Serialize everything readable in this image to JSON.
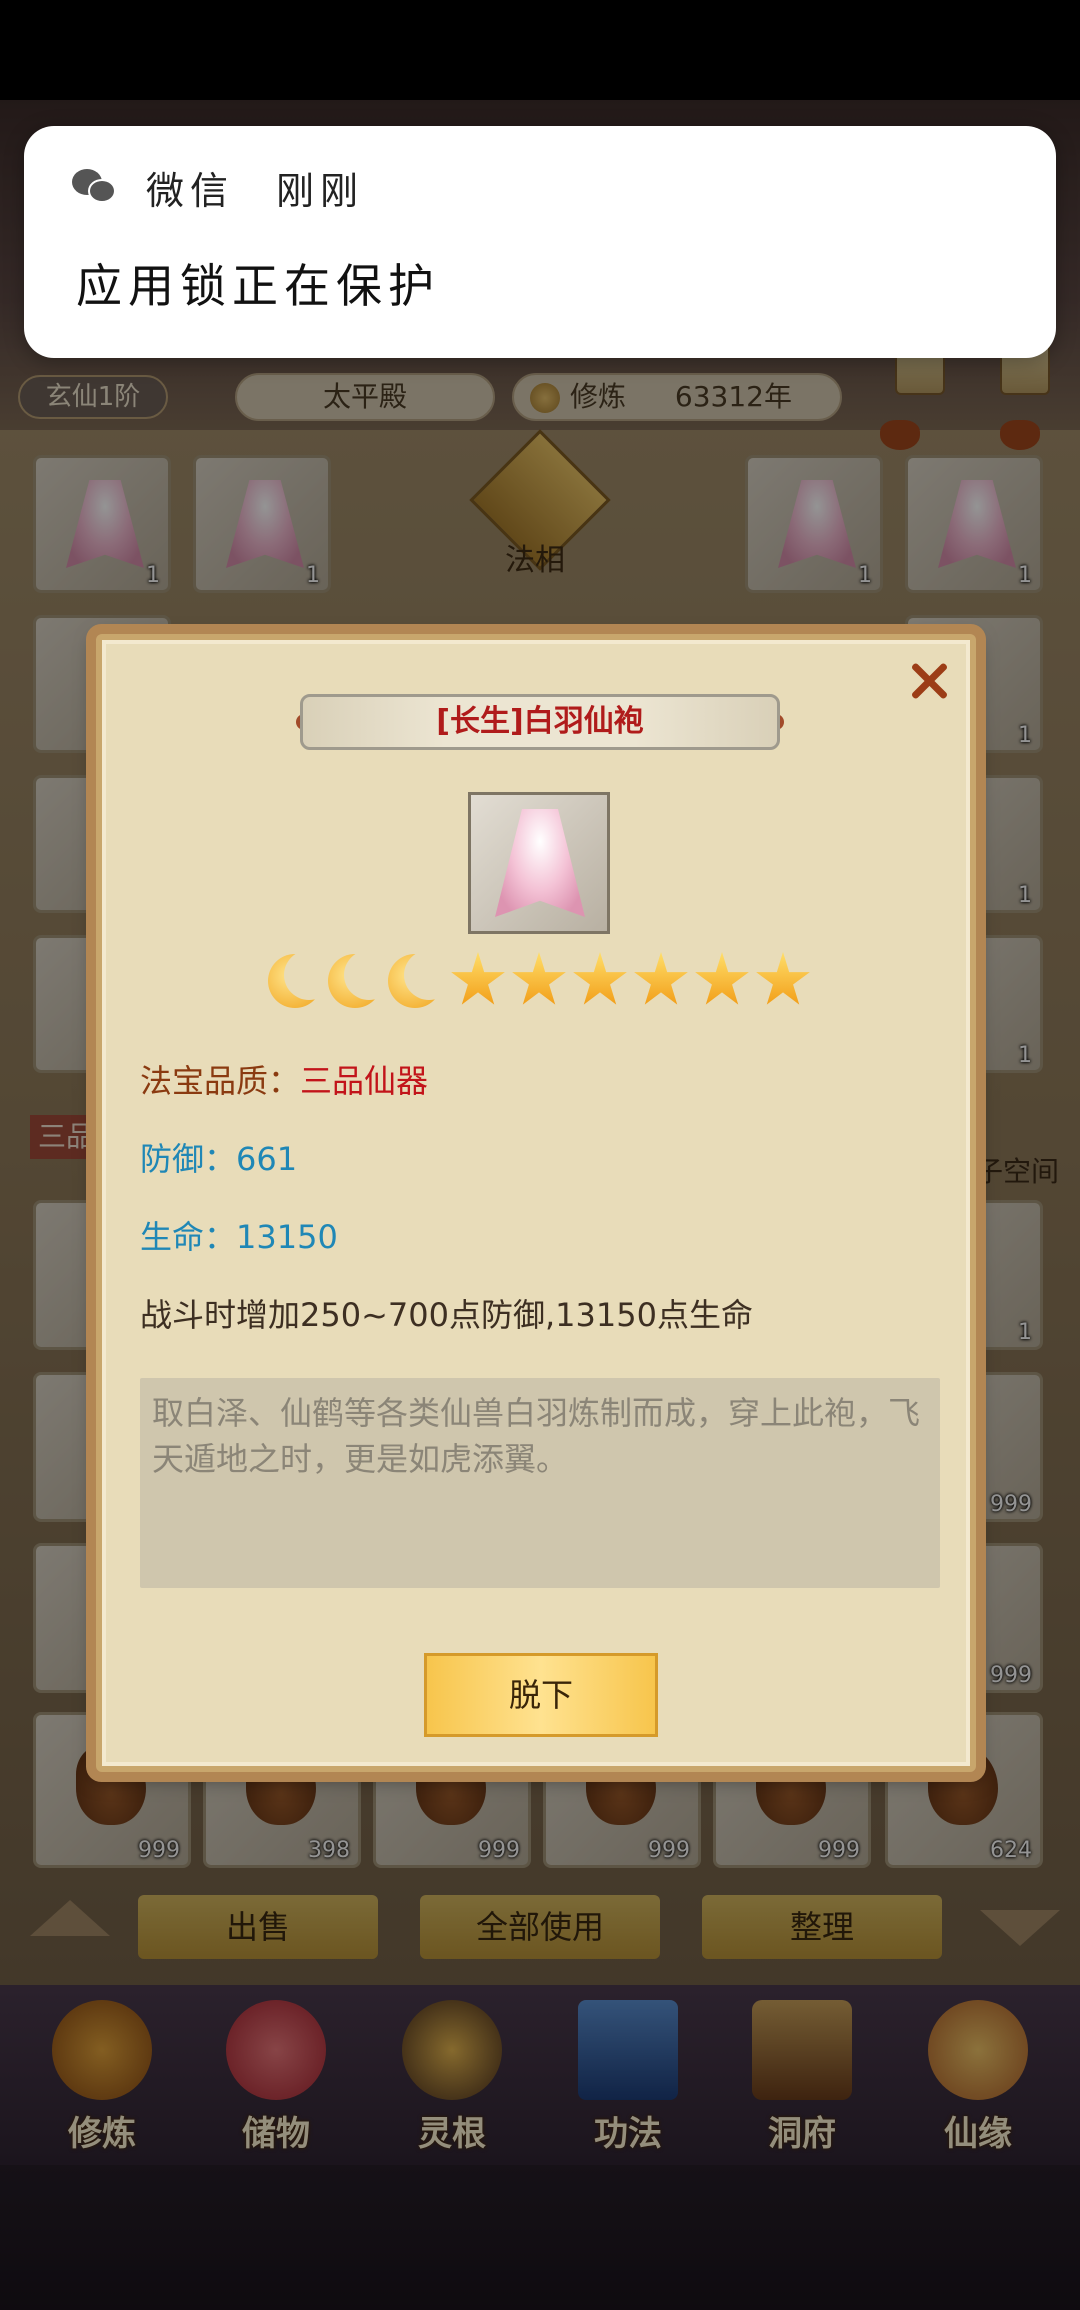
{
  "notification": {
    "app": "微信",
    "time": "刚刚",
    "body": "应用锁正在保护"
  },
  "header": {
    "rank": "玄仙1阶",
    "hall": "太平殿",
    "cultivation_label": "修炼",
    "cultivation_value": "63312年"
  },
  "center": {
    "faxiang_label": "法相"
  },
  "grid_side": {
    "tag_left": "三品",
    "space_label": "子空间"
  },
  "inventory": {
    "top_row_qty": [
      "1",
      "1",
      "1",
      "1"
    ],
    "right_col_qty": [
      "1",
      "1",
      "1"
    ],
    "bottom_row_qty": [
      "999",
      "398",
      "999",
      "999",
      "999",
      "624"
    ],
    "right_side_qty": [
      "1",
      "999",
      "999"
    ]
  },
  "dialog": {
    "title": "[长生]白羽仙袍",
    "rating": {
      "moons": 3,
      "stars": 6
    },
    "quality_label": "法宝品质：",
    "quality_value": "三品仙器",
    "defense": "防御：661",
    "hp": "生命：13150",
    "effect": "战斗时增加250~700点防御,13150点生命",
    "description": "取白泽、仙鹤等各类仙兽白羽炼制而成，穿上此袍，飞天遁地之时，更是如虎添翼。",
    "button": "脱下"
  },
  "actions": {
    "sell": "出售",
    "use_all": "全部使用",
    "sort": "整理"
  },
  "nav": [
    {
      "label": "修炼",
      "icon": "cultivate-icon"
    },
    {
      "label": "储物",
      "icon": "storage-bag-icon"
    },
    {
      "label": "灵根",
      "icon": "spirit-root-icon"
    },
    {
      "label": "功法",
      "icon": "technique-book-icon"
    },
    {
      "label": "洞府",
      "icon": "cave-house-icon"
    },
    {
      "label": "仙缘",
      "icon": "fate-gourd-icon"
    }
  ],
  "colors": {
    "quality": "#c2141a",
    "stat": "#1f87b6",
    "title": "#b01b1b"
  }
}
